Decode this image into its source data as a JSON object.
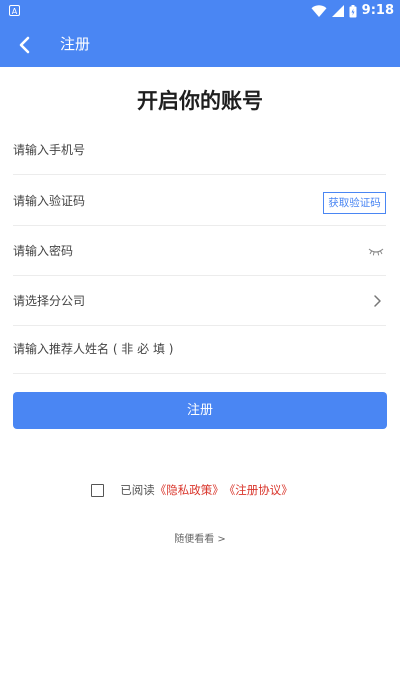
{
  "status_bar": {
    "app_badge": "A",
    "time": "9:18",
    "icons": [
      "wifi-icon",
      "cell-signal-icon",
      "battery-icon"
    ]
  },
  "app_bar": {
    "title": "注册",
    "back_icon": "chevron-left-icon"
  },
  "heading": "开启你的账号",
  "form": {
    "phone_placeholder": "请输入手机号",
    "code_placeholder": "请输入验证码",
    "get_code_label": "获取验证码",
    "password_placeholder": "请输入密码",
    "branch_label": "请选择分公司",
    "referrer_placeholder": "请输入推荐人姓名 ( 非 必 填 )",
    "submit_label": "注册"
  },
  "agreement": {
    "read_label": "已阅读",
    "privacy_link": "《隐私政策》",
    "terms_link": "《注册协议》",
    "checked": false
  },
  "browse_label": "随便看看 >",
  "colors": {
    "primary": "#4a86f3",
    "link_red": "#d9352b"
  }
}
